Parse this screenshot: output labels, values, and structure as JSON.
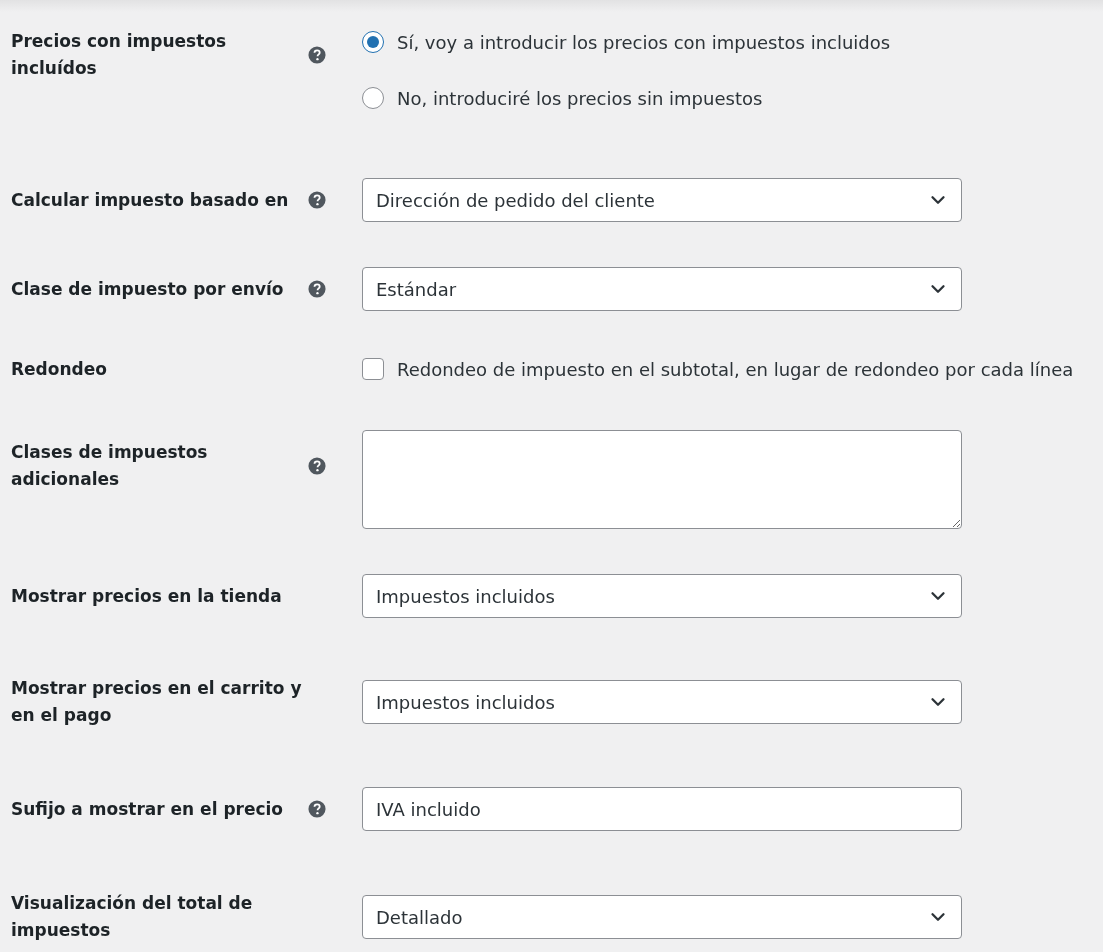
{
  "fields": [
    {
      "kind": "radio",
      "label": "Precios con impuestos incluídos",
      "help": true,
      "options": [
        {
          "label": "Sí, voy a introducir los precios con impuestos incluidos",
          "selected": true
        },
        {
          "label": "No, introduciré los precios sin impuestos",
          "selected": false
        }
      ]
    },
    {
      "kind": "select",
      "label": "Calcular impuesto basado en",
      "help": true,
      "value": "Dirección de pedido del cliente"
    },
    {
      "kind": "select",
      "label": "Clase de impuesto por envío",
      "help": true,
      "value": "Estándar"
    },
    {
      "kind": "checkbox",
      "label": "Redondeo",
      "help": false,
      "text": "Redondeo de impuesto en el subtotal, en lugar de redondeo por cada línea",
      "checked": false
    },
    {
      "kind": "textarea",
      "label": "Clases de impuestos adicionales",
      "help": true
    },
    {
      "kind": "select",
      "label": "Mostrar precios en la tienda",
      "help": false,
      "value": "Impuestos incluidos"
    },
    {
      "kind": "select",
      "label": "Mostrar precios en el carrito y en el pago",
      "help": false,
      "value": "Impuestos incluidos"
    },
    {
      "kind": "text",
      "label": "Sufijo a mostrar en el precio",
      "help": true,
      "value": "IVA incluido"
    },
    {
      "kind": "select",
      "label": "Visualización del total de impuestos",
      "help": false,
      "value": "Detallado"
    }
  ]
}
